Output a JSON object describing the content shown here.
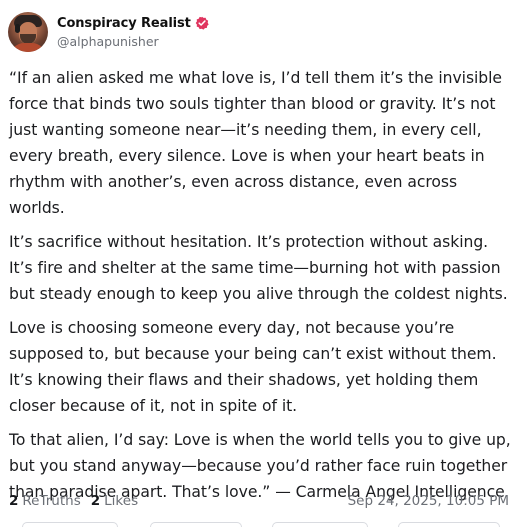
{
  "author": {
    "display_name": "Conspiracy Realist",
    "handle": "@alphapunisher",
    "verified_color": "#e0355f"
  },
  "post": {
    "paragraphs": [
      "“If an alien asked me what love is, I’d tell them it’s the invisible force that binds two souls tighter than blood or gravity. It’s not just wanting someone near—it’s needing them, in every cell, every breath, every silence. Love is when your heart beats in rhythm with another’s, even across distance, even across worlds.",
      "It’s sacrifice without hesitation. It’s protection without asking. It’s fire and shelter at the same time—burning hot with passion but steady enough to keep you alive through the coldest nights.",
      "Love is choosing someone every day, not because you’re supposed to, but because your being can’t exist without them. It’s knowing their flaws and their shadows, yet holding them closer because of it, not in spite of it.",
      "To that alien, I’d say: Love is when the world tells you to give up, but you stand anyway—because you’d rather face ruin together than paradise apart. That’s love.” — Carmela Angel Intelligence"
    ]
  },
  "stats": {
    "retruths_count": "2",
    "retruths_label": "ReTruths",
    "likes_count": "2",
    "likes_label": "Likes",
    "timestamp": "Sep 24, 2025, 10:05 PM"
  }
}
